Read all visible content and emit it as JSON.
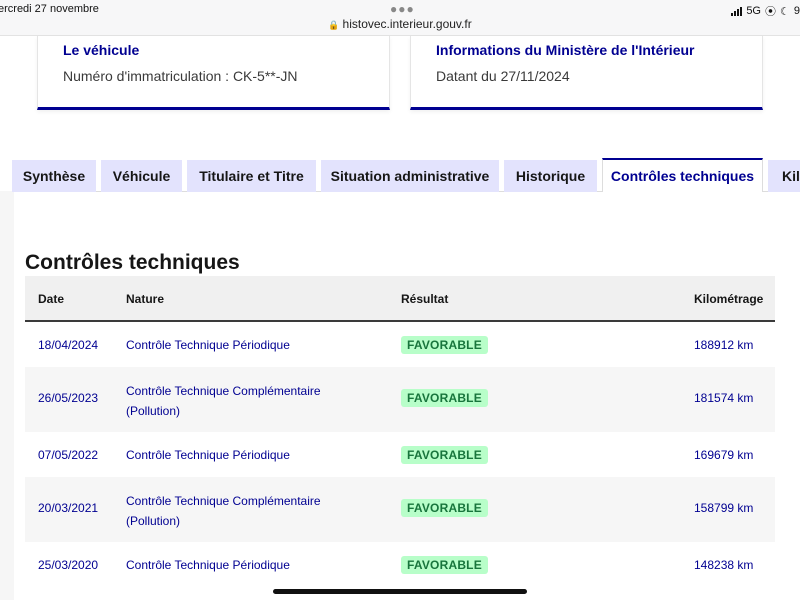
{
  "status_bar": {
    "date": "ercredi 27 novembre",
    "url": "histovec.interieur.gouv.fr",
    "network": "5G",
    "extra": "9"
  },
  "cards": [
    {
      "title": "Le véhicule",
      "text": "Numéro d'immatriculation : CK-5**-JN"
    },
    {
      "title": "Informations du Ministère de l'Intérieur",
      "text": "Datant du 27/11/2024"
    }
  ],
  "tabs": [
    {
      "label": "Synthèse",
      "active": false
    },
    {
      "label": "Véhicule",
      "active": false
    },
    {
      "label": "Titulaire et Titre",
      "active": false
    },
    {
      "label": "Situation administrative",
      "active": false
    },
    {
      "label": "Historique",
      "active": false
    },
    {
      "label": "Contrôles techniques",
      "active": true
    },
    {
      "label": "Kil",
      "active": false
    }
  ],
  "section": {
    "title": "Contrôles techniques"
  },
  "table": {
    "headers": {
      "date": "Date",
      "nature": "Nature",
      "result": "Résultat",
      "km": "Kilométrage"
    },
    "rows": [
      {
        "date": "18/04/2024",
        "nature": "Contrôle Technique Périodique",
        "result": "FAVORABLE",
        "km": "188912 km"
      },
      {
        "date": "26/05/2023",
        "nature": "Contrôle Technique Complémentaire (Pollution)",
        "result": "FAVORABLE",
        "km": "181574 km"
      },
      {
        "date": "07/05/2022",
        "nature": "Contrôle Technique Périodique",
        "result": "FAVORABLE",
        "km": "169679 km"
      },
      {
        "date": "20/03/2021",
        "nature": "Contrôle Technique Complémentaire (Pollution)",
        "result": "FAVORABLE",
        "km": "158799 km"
      },
      {
        "date": "25/03/2020",
        "nature": "Contrôle Technique Périodique",
        "result": "FAVORABLE",
        "km": "148238 km"
      }
    ]
  },
  "colors": {
    "accent": "#000091",
    "tab_background": "#e3e3fd",
    "badge_background": "#b8fec9",
    "badge_text": "#18753c"
  },
  "icons": [
    "lock-icon",
    "more-dots-icon",
    "signal-icon",
    "location-icon",
    "moon-icon"
  ]
}
